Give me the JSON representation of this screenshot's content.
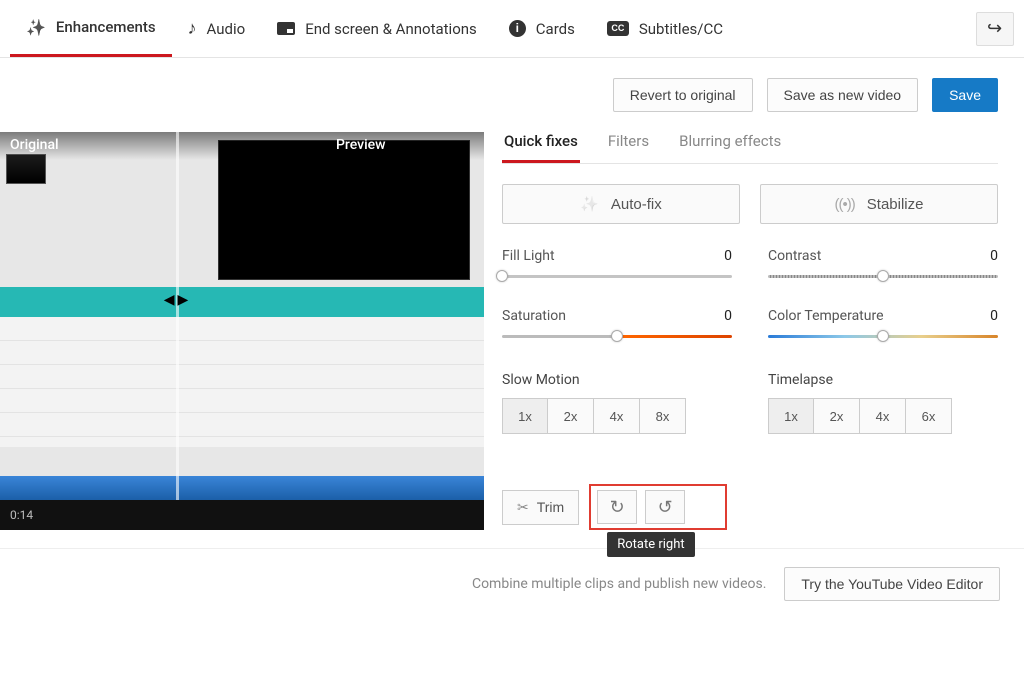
{
  "topnav": {
    "tabs": [
      {
        "label": "Enhancements"
      },
      {
        "label": "Audio"
      },
      {
        "label": "End screen & Annotations"
      },
      {
        "label": "Cards"
      },
      {
        "label": "Subtitles/CC"
      }
    ]
  },
  "actions": {
    "revert": "Revert to original",
    "save_new": "Save as new video",
    "save": "Save"
  },
  "preview": {
    "left_label": "Original",
    "right_label": "Preview",
    "time": "0:14"
  },
  "panel": {
    "subtabs": [
      {
        "label": "Quick fixes"
      },
      {
        "label": "Filters"
      },
      {
        "label": "Blurring effects"
      }
    ],
    "autofix": "Auto-fix",
    "stabilize": "Stabilize",
    "sliders": {
      "fill_light": {
        "label": "Fill Light",
        "value": "0",
        "pos": 0
      },
      "contrast": {
        "label": "Contrast",
        "value": "0",
        "pos": 50
      },
      "saturation": {
        "label": "Saturation",
        "value": "0",
        "pos": 50
      },
      "color_temp": {
        "label": "Color Temperature",
        "value": "0",
        "pos": 50
      }
    },
    "slowmo": {
      "label": "Slow Motion",
      "opts": [
        "1x",
        "2x",
        "4x",
        "8x"
      ],
      "selected": 0
    },
    "timelapse": {
      "label": "Timelapse",
      "opts": [
        "1x",
        "2x",
        "4x",
        "6x"
      ],
      "selected": 0
    },
    "trim": "Trim",
    "tooltip": "Rotate right"
  },
  "footer": {
    "msg": "Combine multiple clips and publish new videos.",
    "cta": "Try the YouTube Video Editor"
  }
}
